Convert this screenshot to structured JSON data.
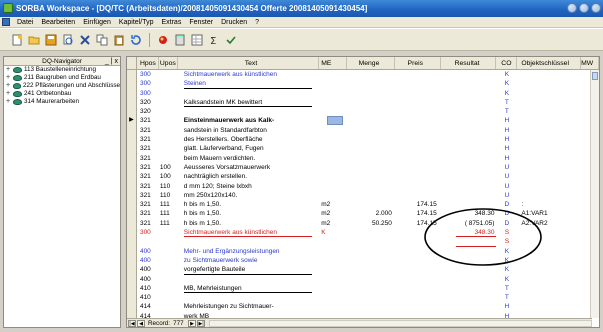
{
  "window": {
    "title": "SORBA Workspace - [DQ/TC (Arbeitsdaten)/20081405091430454 Offerte 20081405091430454]"
  },
  "menu": [
    "Datei",
    "Bearbeiten",
    "Einfügen",
    "Kapitel/Typ",
    "Extras",
    "Fenster",
    "Drucken",
    "?"
  ],
  "toolbar_icons": [
    "new-doc-icon",
    "open-folder-icon",
    "save-icon",
    "print-preview-icon",
    "close-doc-icon",
    "copy-icon",
    "paste-icon",
    "refresh-icon",
    "sep",
    "paint-icon",
    "calculator-icon",
    "grid-icon",
    "sum-icon",
    "check-icon"
  ],
  "navigator": {
    "title": "DQ-Navigator",
    "close_glyph": "_ | x",
    "items": [
      "113 Baustelleneinrichtung",
      "211 Baugruben und Erdbau",
      "222 Pflästerungen und Abschlüsse",
      "241 Ortbetonbau",
      "314 Maurerarbeiten"
    ]
  },
  "grid": {
    "columns": [
      "",
      "Hpos",
      "Upos",
      "Text",
      "ME",
      "Menge",
      "Preis",
      "Resultat",
      "CO",
      "Objektschlüssel",
      "MW"
    ],
    "rows": [
      {
        "ind": "",
        "hpos": "300",
        "upos": "",
        "text": "Sichtmauerwerk aus künstlichen",
        "me": "",
        "menge": "",
        "preis": "",
        "res": "",
        "co": "K",
        "obj": "",
        "color": "#2a3ad0",
        "underline": false
      },
      {
        "ind": "",
        "hpos": "300",
        "upos": "",
        "text": "Steinen",
        "me": "",
        "menge": "",
        "preis": "",
        "res": "",
        "co": "K",
        "obj": "",
        "color": "#2a3ad0",
        "underline": true
      },
      {
        "ind": "",
        "hpos": "300",
        "upos": "",
        "text": "",
        "me": "",
        "menge": "",
        "preis": "",
        "res": "",
        "co": "K",
        "obj": "",
        "color": "#2a3ad0",
        "underline": false
      },
      {
        "ind": "",
        "hpos": "320",
        "upos": "",
        "text": "Kalksandstein MK bewittert",
        "me": "",
        "menge": "",
        "preis": "",
        "res": "",
        "co": "T",
        "obj": "",
        "color": "#000000",
        "underline": true
      },
      {
        "ind": "",
        "hpos": "320",
        "upos": "",
        "text": "",
        "me": "",
        "menge": "",
        "preis": "",
        "res": "",
        "co": "T",
        "obj": "",
        "color": "#000000",
        "underline": false
      },
      {
        "ind": "▶",
        "hpos": "321",
        "upos": "",
        "text": "Einsteinmauerwerk aus Kalk-",
        "me": "",
        "menge": "",
        "preis": "",
        "res": "",
        "co": "H",
        "obj": "",
        "color": "#000000",
        "underline": false,
        "bold": true,
        "button": true
      },
      {
        "ind": "",
        "hpos": "321",
        "upos": "",
        "text": "sandstein in Standardfarbton",
        "me": "",
        "menge": "",
        "preis": "",
        "res": "",
        "co": "H",
        "obj": "",
        "color": "#000000",
        "underline": false
      },
      {
        "ind": "",
        "hpos": "321",
        "upos": "",
        "text": "des Herstellers. Oberfläche",
        "me": "",
        "menge": "",
        "preis": "",
        "res": "",
        "co": "H",
        "obj": "",
        "color": "#000000",
        "underline": false
      },
      {
        "ind": "",
        "hpos": "321",
        "upos": "",
        "text": "glatt. Läuferverband, Fugen",
        "me": "",
        "menge": "",
        "preis": "",
        "res": "",
        "co": "H",
        "obj": "",
        "color": "#000000",
        "underline": false
      },
      {
        "ind": "",
        "hpos": "321",
        "upos": "",
        "text": "beim Mauern verdichten.",
        "me": "",
        "menge": "",
        "preis": "",
        "res": "",
        "co": "H",
        "obj": "",
        "color": "#000000",
        "underline": false
      },
      {
        "ind": "",
        "hpos": "321",
        "upos": "100",
        "text": "Aeusseres Vorsatzmauerwerk",
        "me": "",
        "menge": "",
        "preis": "",
        "res": "",
        "co": "U",
        "obj": "",
        "color": "#000000",
        "underline": false
      },
      {
        "ind": "",
        "hpos": "321",
        "upos": "100",
        "text": "nachträglich erstellen.",
        "me": "",
        "menge": "",
        "preis": "",
        "res": "",
        "co": "U",
        "obj": "",
        "color": "#000000",
        "underline": false
      },
      {
        "ind": "",
        "hpos": "321",
        "upos": "110",
        "text": "d mm 120; Steine lxbxh",
        "me": "",
        "menge": "",
        "preis": "",
        "res": "",
        "co": "U",
        "obj": "",
        "color": "#000000",
        "underline": false
      },
      {
        "ind": "",
        "hpos": "321",
        "upos": "110",
        "text": "mm 250x120x140.",
        "me": "",
        "menge": "",
        "preis": "",
        "res": "",
        "co": "U",
        "obj": "",
        "color": "#000000",
        "underline": false
      },
      {
        "ind": "",
        "hpos": "321",
        "upos": "111",
        "text": "h bis m 1,50.",
        "me": "m2",
        "menge": "",
        "preis": "174.15",
        "res": "",
        "co": "D",
        "obj": ":",
        "color": "#000000",
        "underline": false
      },
      {
        "ind": "",
        "hpos": "321",
        "upos": "111",
        "text": "h bis m 1,50.",
        "me": "m2",
        "menge": "2.000",
        "preis": "174.15",
        "res": "348.30",
        "co": "D",
        "obj": "A1:VAR1",
        "color": "#000000",
        "underline": false
      },
      {
        "ind": "",
        "hpos": "321",
        "upos": "111",
        "text": "h bis m 1,50.",
        "me": "m2",
        "menge": "50.250",
        "preis": "174.15",
        "res": "(     8751.05)",
        "co": "D",
        "obj": "A2:VAR2",
        "color": "#000000",
        "underline": false
      },
      {
        "ind": "",
        "hpos": "300",
        "upos": "",
        "text": "Sichtmauerwerk aus künstlichen",
        "me": "K",
        "menge": "",
        "preis": "",
        "res": "348.30",
        "co": "S",
        "obj": "",
        "color": "#d42020",
        "underline": true
      },
      {
        "ind": "",
        "hpos": "",
        "upos": "",
        "text": "",
        "me": "",
        "menge": "",
        "preis": "",
        "res": "",
        "co": "S",
        "obj": "",
        "color": "#d42020",
        "underline": false
      },
      {
        "ind": "",
        "hpos": "400",
        "upos": "",
        "text": "Mehr- und Ergänzungsleistungen",
        "me": "",
        "menge": "",
        "preis": "",
        "res": "",
        "co": "K",
        "obj": "",
        "color": "#2a3ad0",
        "underline": false
      },
      {
        "ind": "",
        "hpos": "400",
        "upos": "",
        "text": "zu Sichtmauerwerk sowie",
        "me": "",
        "menge": "",
        "preis": "",
        "res": "",
        "co": "K",
        "obj": "",
        "color": "#2a3ad0",
        "underline": false
      },
      {
        "ind": "",
        "hpos": "400",
        "upos": "",
        "text": "vorgefertigte Bauteile",
        "me": "",
        "menge": "",
        "preis": "",
        "res": "",
        "co": "K",
        "obj": "",
        "color": "#000000",
        "underline": true
      },
      {
        "ind": "",
        "hpos": "400",
        "upos": "",
        "text": "",
        "me": "",
        "menge": "",
        "preis": "",
        "res": "",
        "co": "K",
        "obj": "",
        "color": "#000000",
        "underline": false
      },
      {
        "ind": "",
        "hpos": "410",
        "upos": "",
        "text": "MB, Mehrleistungen",
        "me": "",
        "menge": "",
        "preis": "",
        "res": "",
        "co": "T",
        "obj": "",
        "color": "#000000",
        "underline": true
      },
      {
        "ind": "",
        "hpos": "410",
        "upos": "",
        "text": "",
        "me": "",
        "menge": "",
        "preis": "",
        "res": "",
        "co": "T",
        "obj": "",
        "color": "#000000",
        "underline": false
      },
      {
        "ind": "",
        "hpos": "414",
        "upos": "",
        "text": "Mehrleistungen zu Sichtmauer-",
        "me": "",
        "menge": "",
        "preis": "",
        "res": "",
        "co": "H",
        "obj": "",
        "color": "#000000",
        "underline": false
      },
      {
        "ind": "",
        "hpos": "414",
        "upos": "",
        "text": "werk MB",
        "me": "",
        "menge": "",
        "preis": "",
        "res": "",
        "co": "H",
        "obj": "",
        "color": "#000000",
        "underline": false
      }
    ]
  },
  "statusbar": {
    "record_label": "Record:",
    "record_value": "777"
  }
}
